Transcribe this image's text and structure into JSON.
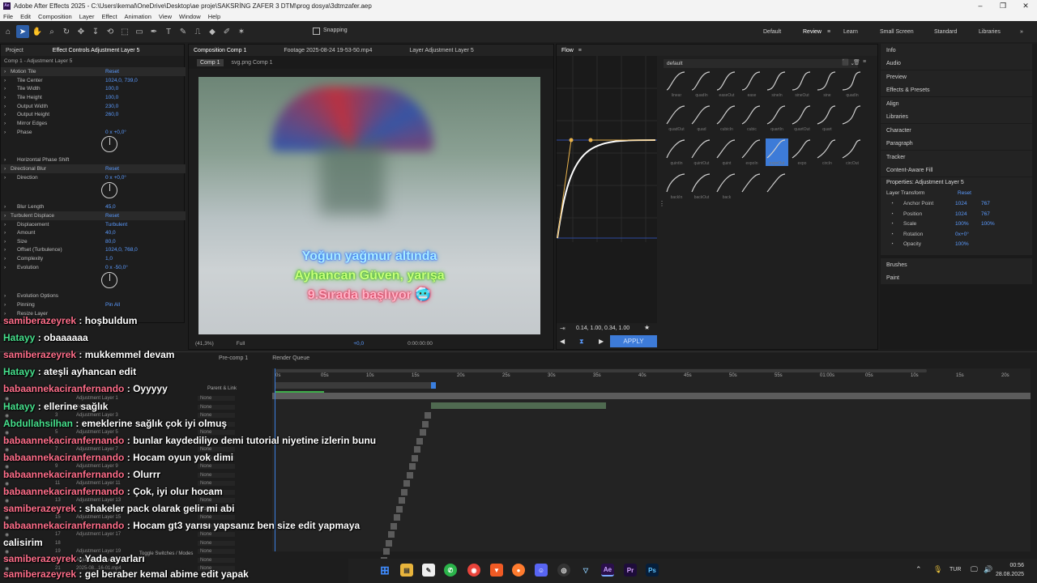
{
  "window": {
    "title": "Adobe After Effects 2025 - C:\\Users\\kemal\\OneDrive\\Desktop\\ae proje\\SAKSRİNG ZAFER 3 DTM\\prog dosya\\3dtmzafer.aep",
    "logo": "Ae"
  },
  "menu": [
    "File",
    "Edit",
    "Composition",
    "Layer",
    "Effect",
    "Animation",
    "View",
    "Window",
    "Help"
  ],
  "toolbar": {
    "snapping": "Snapping"
  },
  "workspaces": [
    "Default",
    "Review",
    "Learn",
    "Small Screen",
    "Standard",
    "Libraries"
  ],
  "active_workspace": "Review",
  "left_panel": {
    "tabs": [
      "Project",
      "Effect Controls Adjustment Layer 5"
    ],
    "subtitle": "Comp 1 - Adjustment Layer 5",
    "rows": [
      {
        "label": "Motion Tile",
        "value": "Reset",
        "fx": true
      },
      {
        "label": "Tile Center",
        "value": "1024,0, 739,0"
      },
      {
        "label": "Tile Width",
        "value": "100,0"
      },
      {
        "label": "Tile Height",
        "value": "100,0"
      },
      {
        "label": "Output Width",
        "value": "230,0"
      },
      {
        "label": "Output Height",
        "value": "260,0"
      },
      {
        "label": "Mirror Edges",
        "value": ""
      },
      {
        "label": "Phase",
        "value": "0 x +0,0°"
      },
      {
        "label": "Horizontal Phase Shift",
        "value": ""
      },
      {
        "label": "Directional Blur",
        "value": "Reset",
        "fx": true
      },
      {
        "label": "Direction",
        "value": "0 x +0,0°"
      },
      {
        "label": "Blur Length",
        "value": "45,0"
      },
      {
        "label": "Turbulent Displace",
        "value": "Reset",
        "fx": true
      },
      {
        "label": "Displacement",
        "value": "Turbulent"
      },
      {
        "label": "Amount",
        "value": "40,0"
      },
      {
        "label": "Size",
        "value": "80,0"
      },
      {
        "label": "Offset (Turbulence)",
        "value": "1024,0, 768,0"
      },
      {
        "label": "Complexity",
        "value": "1,0"
      },
      {
        "label": "Evolution",
        "value": "0 x -50,0°"
      },
      {
        "label": "Evolution Options",
        "value": ""
      },
      {
        "label": "Pinning",
        "value": "Pin All"
      },
      {
        "label": "Resize Layer",
        "value": ""
      }
    ]
  },
  "composition": {
    "tabs": [
      "Composition Comp 1",
      "Footage 2025-08-24 19-53-50.mp4",
      "Layer Adjustment Layer 5"
    ],
    "subtabs": [
      "Comp 1",
      "svg.png Comp 1"
    ],
    "caption_lines": [
      "Yoğun yağmur altında",
      "Ayhancan Güven, yarışa",
      "9.Sırada başlıyor 🥶"
    ],
    "zoom": "(41,3%)",
    "quality": "Full",
    "timecode": "0:00:00:00",
    "exposure": "+0,0"
  },
  "flow": {
    "title": "Flow",
    "preset_set": "default",
    "bezier": "0.14, 1.00, 0.34, 1.00",
    "apply": "APPLY",
    "presets": [
      "linear",
      "quadIn",
      "easeOut",
      "ease",
      "sineIn",
      "sineOut",
      "sine",
      "quadIn",
      "quadOut",
      "quad",
      "cubicIn",
      "cubic",
      "quartIn",
      "quartOut",
      "quart",
      "",
      "quintIn",
      "quintOut",
      "quint",
      "expoIn",
      "expoOut",
      "expo",
      "circIn",
      "circOut",
      "backIn",
      "backOut",
      "back",
      "",
      ""
    ],
    "selected": "expoOut"
  },
  "right_panel": {
    "items": [
      "Info",
      "Audio",
      "Preview",
      "Effects & Presets",
      "Align",
      "Libraries",
      "Character",
      "Paragraph",
      "Tracker",
      "Content-Aware Fill"
    ],
    "properties_title": "Properties: Adjustment Layer 5",
    "layer_transform": "Layer Transform",
    "reset": "Reset",
    "props": [
      {
        "label": "Anchor Point",
        "v1": "1024",
        "v2": "767"
      },
      {
        "label": "Position",
        "v1": "1024",
        "v2": "767"
      },
      {
        "label": "Scale",
        "v1": "100%",
        "v2": "100%"
      },
      {
        "label": "Rotation",
        "v1": "0x+0°",
        "v2": ""
      },
      {
        "label": "Opacity",
        "v1": "100%",
        "v2": ""
      }
    ],
    "bottom": [
      "Brushes",
      "Paint"
    ]
  },
  "timeline": {
    "tabs": [
      "Pre-comp 1",
      "Render Queue"
    ],
    "parent_link": "Parent & Link",
    "none": "None",
    "toggle": "Toggle Switches / Modes",
    "ruler": [
      "0s",
      "05s",
      "10s",
      "15s",
      "20s",
      "25s",
      "30s",
      "35s",
      "40s",
      "45s",
      "50s",
      "55s",
      "01:00s",
      "05s",
      "10s",
      "15s",
      "20s"
    ],
    "layers": [
      "Adjustment Layer 1",
      "24-25.mp4",
      "Adjustment Layer 3",
      "",
      "Adjustment Layer 5",
      "",
      "Adjustment Layer 7",
      "",
      "Adjustment Layer 9",
      "",
      "Adjustment Layer 11",
      "",
      "Adjustment Layer 13",
      "",
      "Adjustment Layer 15",
      "",
      "Adjustment Layer 17",
      "",
      "Adjustment Layer 19",
      "Adjustment Layer 5",
      "2025-08...16-01.mp4"
    ],
    "layer_numbers": [
      "3",
      "4",
      "5",
      "6",
      "7",
      "8",
      "9",
      "10",
      "11",
      "12",
      "13",
      "14",
      "15",
      "16",
      "17",
      "18",
      "19",
      "20",
      "21"
    ]
  },
  "chat": [
    {
      "user": "samiberazeyrek",
      "msg": "hoşbuldum",
      "c": "u1"
    },
    {
      "user": "Hatayy",
      "msg": "obaaaaaa",
      "c": "u2"
    },
    {
      "user": "samiberazeyrek",
      "msg": "mukkemmel devam",
      "c": "u1"
    },
    {
      "user": "Hatayy",
      "msg": "ateşli ayhancan edit",
      "c": "u2"
    },
    {
      "user": "babaannekaciranfernando",
      "msg": "Oyyyyy",
      "c": "u1"
    },
    {
      "user": "Hatayy",
      "msg": "ellerine sağlık",
      "c": "u2"
    },
    {
      "user": "Abdullahsilhan",
      "msg": "emeklerine sağlık çok iyi olmuş",
      "c": "u2"
    },
    {
      "user": "babaannekaciranfernando",
      "msg": "bunlar kaydediliyo demi tutorial niyetine izlerin bunu",
      "c": "u1"
    },
    {
      "user": "babaannekaciranfernando",
      "msg": "Hocam oyun yok dimi",
      "c": "u1"
    },
    {
      "user": "babaannekaciranfernando",
      "msg": "Olurrr",
      "c": "u1"
    },
    {
      "user": "babaannekaciranfernando",
      "msg": "Çok, iyi olur hocam",
      "c": "u1"
    },
    {
      "user": "samiberazeyrek",
      "msg": "shakeler pack olarak gelir mi abi",
      "c": "u1"
    },
    {
      "user": "babaannekaciranfernando",
      "msg": "Hocam gt3 yarısı yapsanız ben size edit yapmaya",
      "c": "u1"
    },
    {
      "user": "",
      "msg": "calisirim",
      "c": "u1"
    },
    {
      "user": "samiberazeyrek",
      "msg": "Yada ayarları",
      "c": "u1"
    },
    {
      "user": "samiberazeyrek",
      "msg": "gel beraber kemal abime edit yapak",
      "c": "u1"
    }
  ],
  "taskbar": {
    "lang": "TUR",
    "time": "00:56",
    "date": "28.08.2025",
    "apps": [
      "start",
      "files",
      "notes",
      "whatsapp",
      "chrome",
      "brave",
      "firefox",
      "discord",
      "obs",
      "vpn",
      "Ae",
      "Pr",
      "Ps"
    ]
  }
}
